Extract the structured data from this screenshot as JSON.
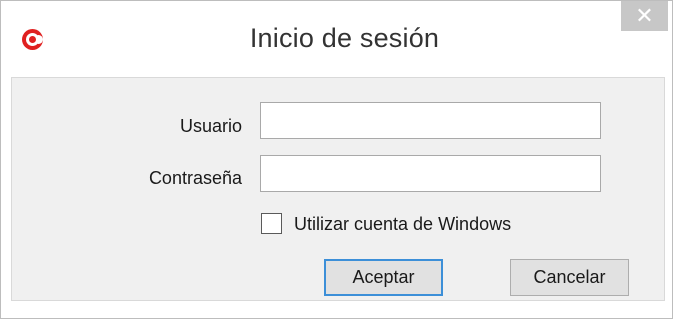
{
  "window": {
    "title": "Inicio de sesión",
    "app_icon": "app-logo-icon",
    "close_glyph": "✕"
  },
  "form": {
    "username_label": "Usuario",
    "username_value": "",
    "password_label": "Contraseña",
    "password_value": "",
    "windows_account_label": "Utilizar cuenta de Windows",
    "windows_account_checked": false
  },
  "buttons": {
    "accept_label": "Aceptar",
    "cancel_label": "Cancelar"
  },
  "colors": {
    "brand_red": "#e02020",
    "default_button_border": "#3c8fd8",
    "client_bg": "#f0f0f0"
  }
}
